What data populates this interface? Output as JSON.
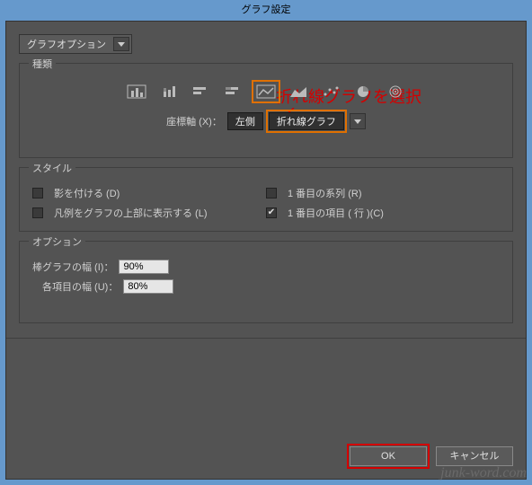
{
  "title": "グラフ設定",
  "tab": "グラフオプション",
  "annotation": "折れ線グラフを選択",
  "group_type": {
    "legend": "種類",
    "axis_label": "座標軸 (X)：",
    "axis_side": "左側",
    "axis_type": "折れ線グラフ"
  },
  "group_style": {
    "legend": "スタイル",
    "shadow": "影を付ける (D)",
    "first_series": "1 番目の系列 (R)",
    "legend_top": "凡例をグラフの上部に表示する (L)",
    "first_row": "1 番目の項目 ( 行 )(C)"
  },
  "group_options": {
    "legend": "オプション",
    "bar_width_label": "棒グラフの幅 (I)：",
    "bar_width_value": "90%",
    "item_width_label": "各項目の幅 (U)：",
    "item_width_value": "80%"
  },
  "buttons": {
    "ok": "OK",
    "cancel": "キャンセル"
  },
  "watermark": "junk-word.com"
}
